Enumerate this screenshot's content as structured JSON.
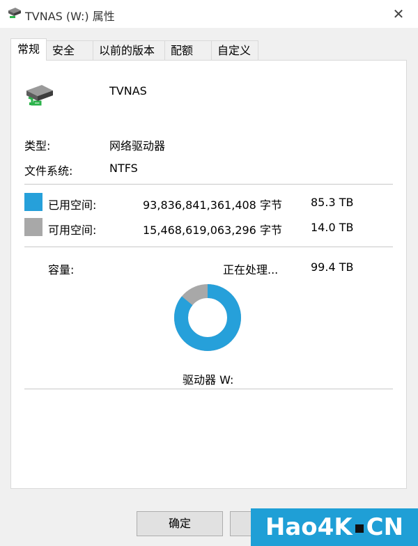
{
  "window": {
    "title": "TVNAS (W:) 属性",
    "close_symbol": "✕"
  },
  "tabs": [
    {
      "label": "常规",
      "active": true
    },
    {
      "label": "安全",
      "active": false
    },
    {
      "label": "以前的版本",
      "active": false
    },
    {
      "label": "配额",
      "active": false
    },
    {
      "label": "自定义",
      "active": false
    }
  ],
  "drive": {
    "name": "TVNAS",
    "icon": "network-drive-icon",
    "type_label": "类型:",
    "type_value": "网络驱动器",
    "fs_label": "文件系统:",
    "fs_value": "NTFS"
  },
  "usage": {
    "used_label": "已用空间:",
    "used_bytes": "93,836,841,361,408 字节",
    "used_size": "85.3 TB",
    "used_color": "#26a0da",
    "free_label": "可用空间:",
    "free_bytes": "15,468,619,063,296 字节",
    "free_size": "14.0 TB",
    "free_color": "#a8a8a8",
    "capacity_label": "容量:",
    "capacity_status": "正在处理...",
    "capacity_size": "99.4 TB",
    "used_fraction": 0.858,
    "drive_label": "驱动器 W:"
  },
  "buttons": {
    "ok": "确定",
    "cancel": ""
  },
  "watermark": {
    "left": "Hao4K",
    "right": "CN"
  }
}
